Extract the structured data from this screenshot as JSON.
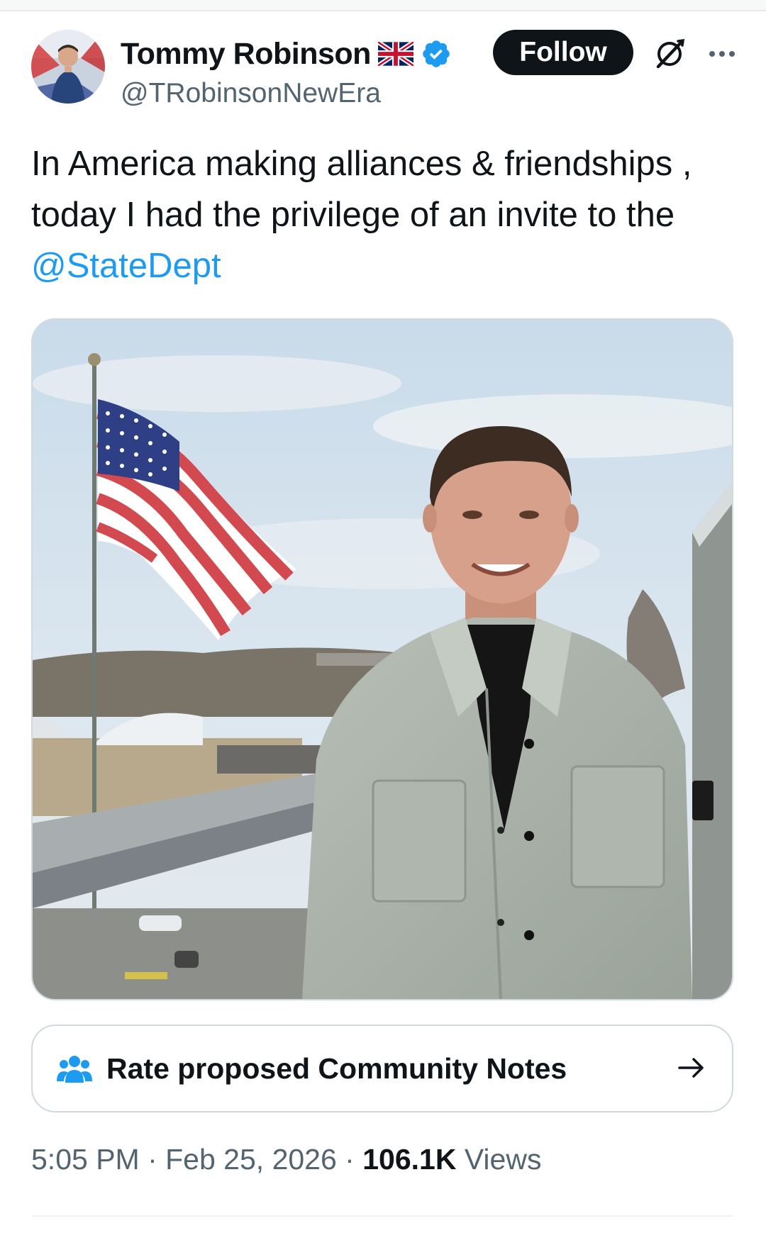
{
  "author": {
    "display_name": "Tommy Robinson",
    "handle": "@TRobinsonNewEra",
    "flag_icon": "uk-flag-icon",
    "verified_icon": "verified-badge-icon",
    "verified_color": "#1d9bf0"
  },
  "header": {
    "follow_label": "Follow",
    "grok_icon": "grok-icon",
    "more_icon": "more-dots-icon"
  },
  "tweet": {
    "text_before_mention": "In America making alliances & friendships , today I had the privilege of an invite to the ",
    "mention": "@StateDept"
  },
  "media": {
    "image_icon": "photo-flag-balcony"
  },
  "community_notes": {
    "label": "Rate proposed Community Notes",
    "icon": "people-group-icon",
    "arrow_icon": "arrow-right-icon"
  },
  "meta": {
    "time": "5:05 PM",
    "separator": " · ",
    "date": "Feb 25, 2026",
    "views_count": "106.1K",
    "views_label": " Views"
  },
  "colors": {
    "link": "#1d9bf0",
    "text": "#0f1419",
    "secondary": "#536471",
    "border": "#cfd9de"
  }
}
